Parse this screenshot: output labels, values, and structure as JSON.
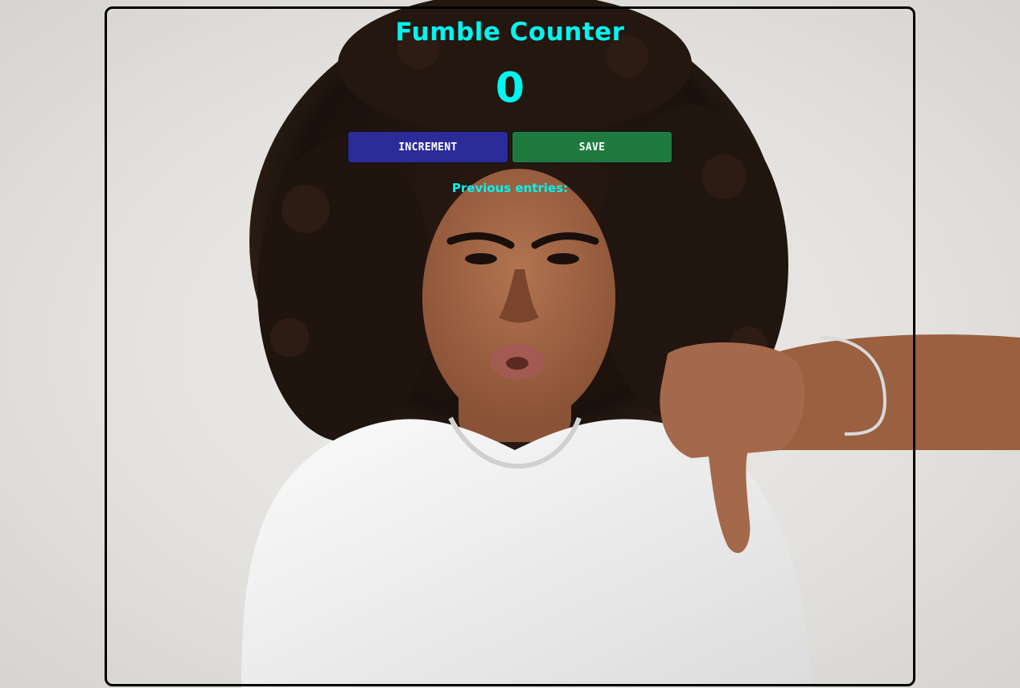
{
  "app": {
    "title": "Fumble Counter",
    "count": "0",
    "increment_label": "INCREMENT",
    "save_label": "SAVE",
    "previous_entries_label": "Previous entries:",
    "previous_entries": []
  },
  "colors": {
    "accent_text": "#00f5f0",
    "increment_button": "#2b2b9a",
    "save_button": "#1f7a40",
    "frame_border": "#000000"
  },
  "background": {
    "icon": "thumbs-down-woman-photo"
  }
}
